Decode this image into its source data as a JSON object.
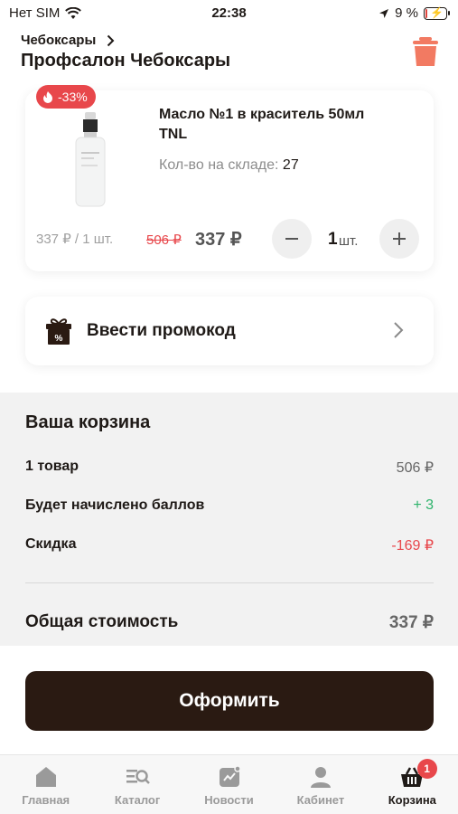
{
  "status_bar": {
    "carrier": "Нет SIM",
    "time": "22:38",
    "battery": "9 %",
    "battery_level": 0.09
  },
  "header": {
    "city": "Чебоксары",
    "salon": "Профсалон Чебоксары"
  },
  "product": {
    "discount": "-33%",
    "name": "Масло №1 в краситель 50мл TNL",
    "stock_label": "Кол-во на складе:",
    "stock_value": "27",
    "unit_price": "337 ₽ / 1 шт.",
    "old_price": "506 ₽",
    "new_price": "337 ₽",
    "quantity": "1",
    "quantity_unit": "шт."
  },
  "promo": {
    "label": "Ввести промокод"
  },
  "summary": {
    "title": "Ваша корзина",
    "rows": [
      {
        "label": "1 товар",
        "value": "506 ₽"
      },
      {
        "label": "Будет начислено баллов",
        "value": "+ 3"
      },
      {
        "label": "Скидка",
        "value": "-169 ₽"
      }
    ],
    "total_label": "Общая стоимость",
    "total_value": "337 ₽"
  },
  "checkout": {
    "label": "Оформить"
  },
  "tabs": [
    {
      "label": "Главная",
      "icon": "home-icon"
    },
    {
      "label": "Каталог",
      "icon": "catalog-icon"
    },
    {
      "label": "Новости",
      "icon": "news-icon"
    },
    {
      "label": "Кабинет",
      "icon": "profile-icon"
    },
    {
      "label": "Корзина",
      "icon": "basket-icon",
      "badge": "1",
      "active": true
    }
  ],
  "colors": {
    "accent": "#e8474b",
    "button": "#2a1a12",
    "green": "#2db36b",
    "trash": "#f27a62"
  }
}
